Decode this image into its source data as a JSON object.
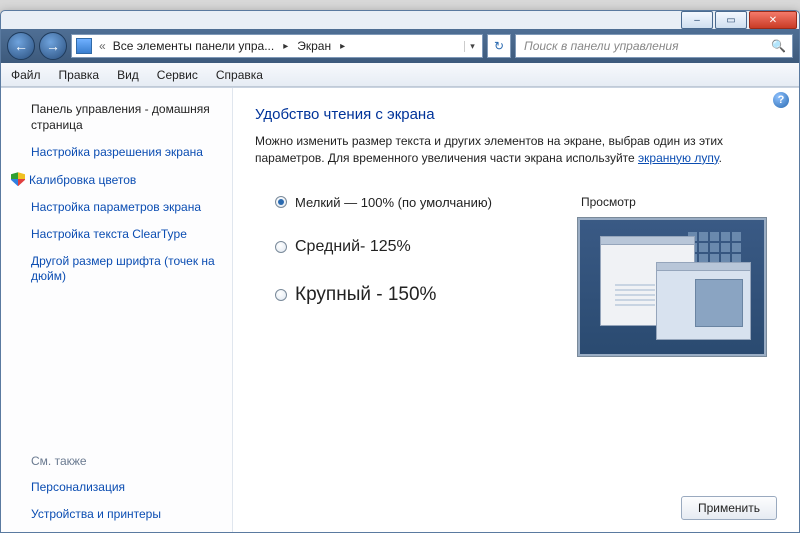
{
  "titlebar": {
    "minimize": "–",
    "maximize": "▭",
    "close": "✕"
  },
  "nav": {
    "back": "←",
    "forward": "→",
    "breadcrumb_prefix": "«",
    "breadcrumb_seg1": "Все элементы панели упра...",
    "breadcrumb_seg2": "Экран",
    "refresh": "↻",
    "search_placeholder": "Поиск в панели управления"
  },
  "menu": {
    "file": "Файл",
    "edit": "Правка",
    "view": "Вид",
    "service": "Сервис",
    "help": "Справка"
  },
  "help_icon": "?",
  "sidebar": {
    "home": "Панель управления - домашняя страница",
    "items": [
      "Настройка разрешения экрана",
      "Калибровка цветов",
      "Настройка параметров экрана",
      "Настройка текста ClearType",
      "Другой размер шрифта (точек на дюйм)"
    ],
    "seealso_hdr": "См. также",
    "seealso": [
      "Персонализация",
      "Устройства и принтеры"
    ]
  },
  "main": {
    "title": "Удобство чтения с экрана",
    "desc_part1": "Можно изменить размер текста и других элементов на экране, выбрав один из этих параметров. Для временного увеличения части экрана используйте ",
    "desc_link": "экранную лупу",
    "desc_part2": ".",
    "options": [
      {
        "label": "Мелкий — 100% (по умолчанию)",
        "checked": true,
        "cls": ""
      },
      {
        "label": "Средний- 125%",
        "checked": false,
        "cls": "big1"
      },
      {
        "label": "Крупный - 150%",
        "checked": false,
        "cls": "big2"
      }
    ],
    "preview_label": "Просмотр",
    "apply": "Применить"
  }
}
